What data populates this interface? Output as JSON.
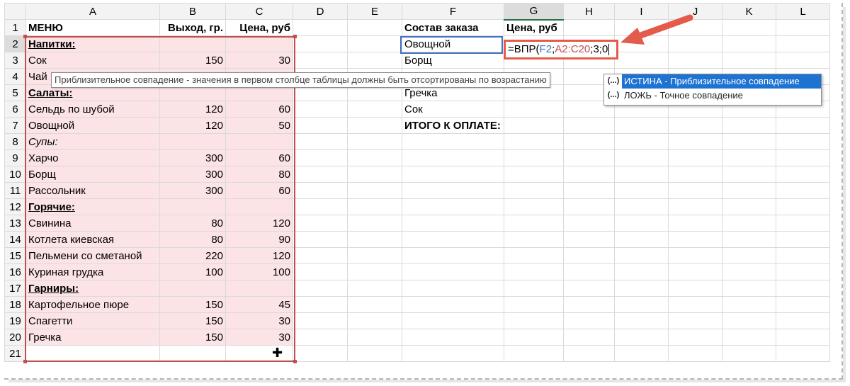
{
  "columns": [
    "A",
    "B",
    "C",
    "D",
    "E",
    "F",
    "G",
    "H",
    "I",
    "J",
    "K",
    "L"
  ],
  "rows": [
    {
      "n": "1",
      "a": "МЕНЮ",
      "b": "Выход, гр.",
      "c": "Цена, руб",
      "f": "Состав заказа",
      "g": "Цена, руб"
    },
    {
      "n": "2",
      "a": "Напитки:",
      "b": "",
      "c": "",
      "f": "Овощной",
      "g": ""
    },
    {
      "n": "3",
      "a": "Сок",
      "b": "150",
      "c": "30",
      "f": "",
      "g": ""
    },
    {
      "n": "4",
      "a": "Чай",
      "b": "",
      "c": "",
      "f": "",
      "g": ""
    },
    {
      "n": "5",
      "a": "Салаты:",
      "b": "",
      "c": "",
      "f": "Гречка",
      "g": ""
    },
    {
      "n": "6",
      "a": "Сельдь по шубой",
      "b": "120",
      "c": "60",
      "f": "Сок",
      "g": ""
    },
    {
      "n": "7",
      "a": "Овощной",
      "b": "120",
      "c": "50",
      "f": "ИТОГО К ОПЛАТЕ:",
      "g": ""
    },
    {
      "n": "8",
      "a": "Супы:",
      "b": "",
      "c": "",
      "f": "",
      "g": ""
    },
    {
      "n": "9",
      "a": "Харчо",
      "b": "300",
      "c": "60",
      "f": "",
      "g": ""
    },
    {
      "n": "10",
      "a": "Борщ",
      "b": "300",
      "c": "80",
      "f": "",
      "g": ""
    },
    {
      "n": "11",
      "a": "Рассольник",
      "b": "300",
      "c": "60",
      "f": "",
      "g": ""
    },
    {
      "n": "12",
      "a": "Горячие:",
      "b": "",
      "c": "",
      "f": "",
      "g": ""
    },
    {
      "n": "13",
      "a": "Свинина",
      "b": "80",
      "c": "120",
      "f": "",
      "g": ""
    },
    {
      "n": "14",
      "a": "Котлета киевская",
      "b": "80",
      "c": "90",
      "f": "",
      "g": ""
    },
    {
      "n": "15",
      "a": "Пельмени со сметаной",
      "b": "220",
      "c": "120",
      "f": "",
      "g": ""
    },
    {
      "n": "16",
      "a": "Куриная грудка",
      "b": "100",
      "c": "100",
      "f": "",
      "g": ""
    },
    {
      "n": "17",
      "a": "Гарниры:",
      "b": "",
      "c": "",
      "f": "",
      "g": ""
    },
    {
      "n": "18",
      "a": "Картофельное пюре",
      "b": "150",
      "c": "45",
      "f": "",
      "g": ""
    },
    {
      "n": "19",
      "a": "Спагетти",
      "b": "150",
      "c": "30",
      "f": "",
      "g": ""
    },
    {
      "n": "20",
      "a": "Гречка",
      "b": "150",
      "c": "30",
      "f": "",
      "g": ""
    },
    {
      "n": "21",
      "a": "",
      "b": "",
      "c": "",
      "f": "",
      "g": ""
    }
  ],
  "order_row3": "Борщ",
  "formula": {
    "prefix": "=ВПР(",
    "arg1": "F2",
    "sep1": ";",
    "arg2": "A2:C20",
    "rest": ";3;0"
  },
  "tooltip": "Приблизительное совпадение - значения в первом столбце таблицы должны быть отсортированы по возрастанию",
  "autocomplete": [
    {
      "icon": "(...)",
      "label": "ИСТИНА - Приблизительное совпадение",
      "selected": true
    },
    {
      "icon": "(...)",
      "label": "ЛОЖЬ - Точное совпадение",
      "selected": false
    }
  ],
  "colors": {
    "range_border": "#c0504d",
    "range_fill": "#fbe3e6",
    "f2_border": "#4472c4",
    "highlight": "#e35b4b",
    "menu_selected": "#1e73d2"
  }
}
